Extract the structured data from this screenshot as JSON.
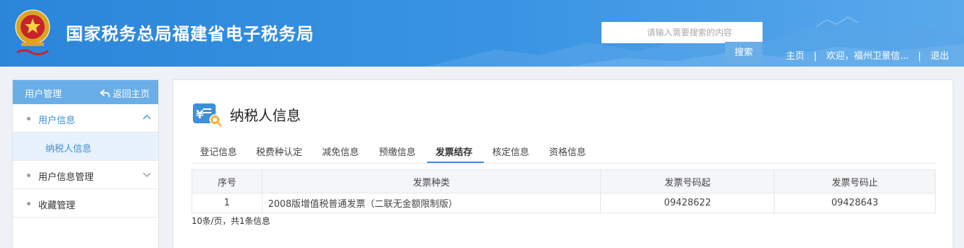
{
  "header": {
    "site_title": "国家税务总局福建省电子税务局",
    "search_placeholder": "请输入需要搜索的内容",
    "search_button": "搜索",
    "links": {
      "home": "主页",
      "welcome": "欢迎，福州卫景信...",
      "logout": "退出"
    },
    "separator": "|"
  },
  "sidebar": {
    "title": "用户管理",
    "back_label": "返回主页",
    "items": [
      {
        "label": "用户信息",
        "expanded": true,
        "children": [
          {
            "label": "纳税人信息"
          }
        ]
      },
      {
        "label": "用户信息管理",
        "expanded": false
      },
      {
        "label": "收藏管理"
      }
    ]
  },
  "main": {
    "title": "纳税人信息",
    "tabs": [
      {
        "label": "登记信息"
      },
      {
        "label": "税费种认定"
      },
      {
        "label": "减免信息"
      },
      {
        "label": "预缴信息"
      },
      {
        "label": "发票结存",
        "active": true
      },
      {
        "label": "核定信息"
      },
      {
        "label": "资格信息"
      }
    ],
    "table": {
      "columns": [
        "序号",
        "发票种类",
        "发票号码起",
        "发票号码止"
      ],
      "rows": [
        [
          "1",
          "2008版增值税普通发票（二联无金额限制版）",
          "09428622",
          "09428643"
        ]
      ]
    },
    "pager_text": "10条/页，共1条信息"
  },
  "colors": {
    "header_blue": "#3b95e4",
    "accent": "#3d8fd8",
    "sidebar_head": "#6aaee8"
  }
}
